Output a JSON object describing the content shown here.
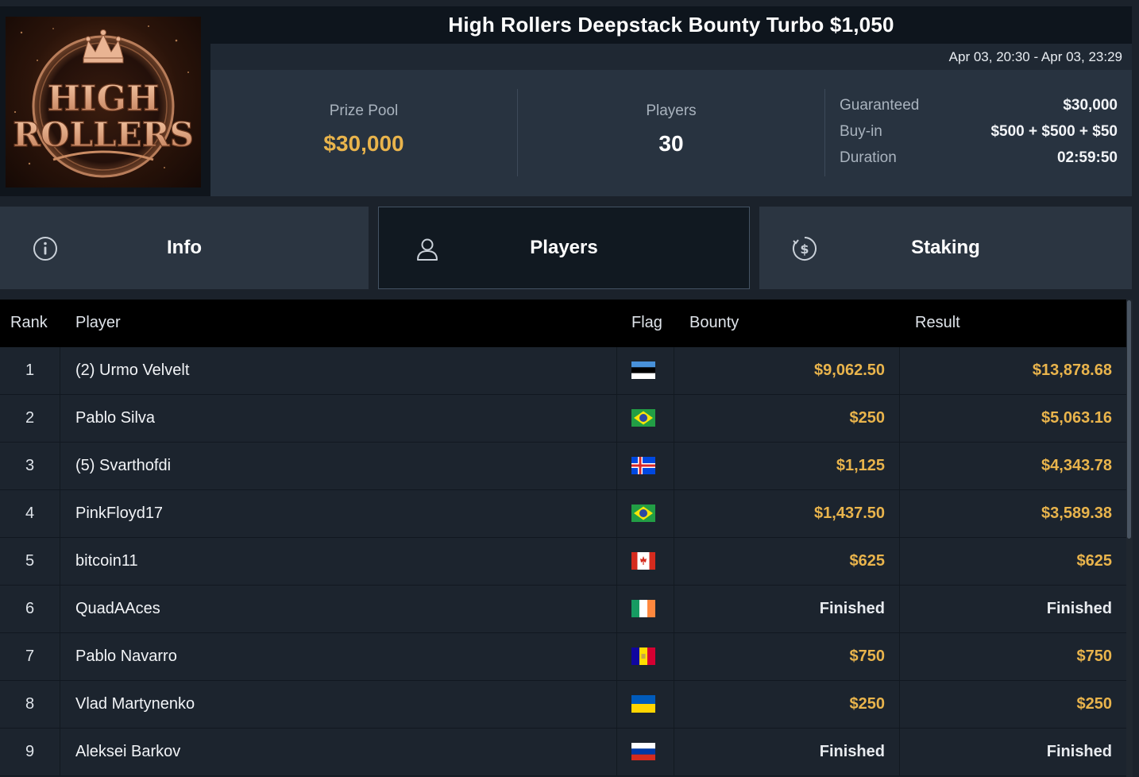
{
  "tournament": {
    "title": "High Rollers Deepstack Bounty Turbo $1,050",
    "dates": "Apr 03, 20:30 - Apr 03, 23:29",
    "logo_text_line1": "HIGH",
    "logo_text_line2": "ROLLERS"
  },
  "stats": {
    "prize_pool_label": "Prize Pool",
    "prize_pool_value": "$30,000",
    "players_label": "Players",
    "players_value": "30",
    "details": [
      {
        "label": "Guaranteed",
        "value": "$30,000"
      },
      {
        "label": "Buy-in",
        "value": "$500 + $500 + $50"
      },
      {
        "label": "Duration",
        "value": "02:59:50"
      }
    ]
  },
  "tabs": [
    {
      "label": "Info",
      "icon": "info-icon"
    },
    {
      "label": "Players",
      "icon": "user-icon",
      "active": true
    },
    {
      "label": "Staking",
      "icon": "dollar-coin-icon"
    }
  ],
  "table": {
    "headers": {
      "rank": "Rank",
      "player": "Player",
      "flag": "Flag",
      "bounty": "Bounty",
      "result": "Result"
    },
    "rows": [
      {
        "rank": "1",
        "player": "(2) Urmo Velvelt",
        "flag": "Estonia",
        "bounty": "$9,062.50",
        "result": "$13,878.68"
      },
      {
        "rank": "2",
        "player": "Pablo Silva",
        "flag": "Brazil",
        "bounty": "$250",
        "result": "$5,063.16"
      },
      {
        "rank": "3",
        "player": "(5) Svarthofdi",
        "flag": "Iceland",
        "bounty": "$1,125",
        "result": "$4,343.78"
      },
      {
        "rank": "4",
        "player": "PinkFloyd17",
        "flag": "Brazil",
        "bounty": "$1,437.50",
        "result": "$3,589.38"
      },
      {
        "rank": "5",
        "player": "bitcoin11",
        "flag": "Canada",
        "bounty": "$625",
        "result": "$625"
      },
      {
        "rank": "6",
        "player": "QuadAAces",
        "flag": "Ireland",
        "bounty": "Finished",
        "result": "Finished"
      },
      {
        "rank": "7",
        "player": "Pablo Navarro",
        "flag": "Andorra",
        "bounty": "$750",
        "result": "$750"
      },
      {
        "rank": "8",
        "player": "Vlad Martynenko",
        "flag": "Ukraine",
        "bounty": "$250",
        "result": "$250"
      },
      {
        "rank": "9",
        "player": "Aleksei Barkov",
        "flag": "Russia",
        "bounty": "Finished",
        "result": "Finished"
      }
    ]
  },
  "colors": {
    "accent_gold": "#e9b44c",
    "background": "#1b222b",
    "header_black": "#000000"
  }
}
